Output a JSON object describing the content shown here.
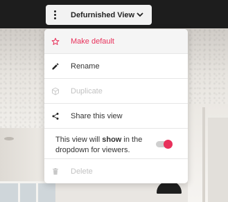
{
  "view_selector": {
    "title": "Defurnished View"
  },
  "menu": {
    "make_default": "Make default",
    "rename": "Rename",
    "duplicate": "Duplicate",
    "share": "Share this view",
    "visibility_prefix": "This view will ",
    "visibility_bold": "show",
    "visibility_suffix": " in the dropdown for viewers.",
    "visibility_enabled": true,
    "delete": "Delete"
  },
  "colors": {
    "accent": "#e8315b",
    "disabled": "#c2c2c2"
  }
}
